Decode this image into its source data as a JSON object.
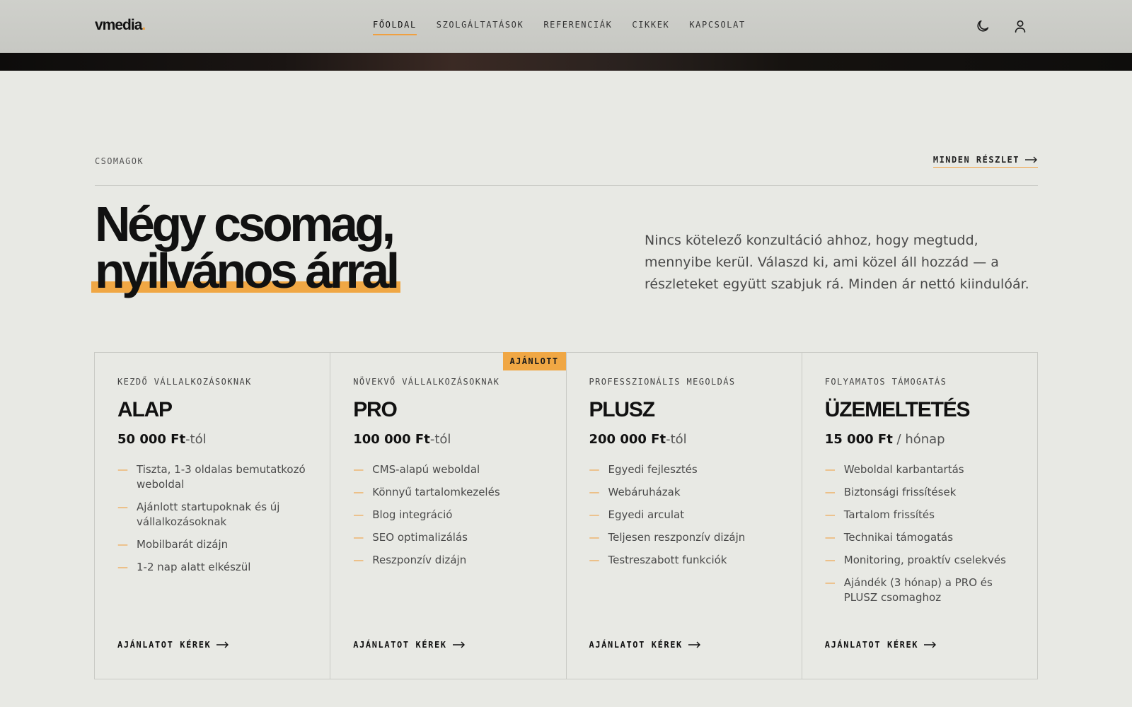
{
  "header": {
    "logo": "vmedia",
    "logo_dot": ".",
    "nav": [
      {
        "label": "FŐOLDAL",
        "active": true
      },
      {
        "label": "SZOLGÁLTATÁSOK",
        "active": false
      },
      {
        "label": "REFERENCIÁK",
        "active": false
      },
      {
        "label": "CIKKEK",
        "active": false
      },
      {
        "label": "KAPCSOLAT",
        "active": false
      }
    ],
    "icons": [
      "moon-icon",
      "user-icon"
    ]
  },
  "section": {
    "eyebrow": "CSOMAGOK",
    "all_link": "MINDEN RÉSZLET",
    "headline_line1": "Négy csomag,",
    "headline_line2": "nyilvános árral",
    "intro": "Nincs kötelező konzultáció ahhoz, hogy megtudd, mennyibe kerül. Válaszd ki, ami közel áll hozzád — a részleteket együtt szabjuk rá. Minden ár nettó kiindulóár."
  },
  "cards": [
    {
      "eyebrow": "KEZDŐ VÁLLALKOZÁSOKNAK",
      "title": "ALAP",
      "price_amount": "50 000 Ft",
      "price_suffix": "-tól",
      "features": [
        "Tiszta, 1-3 oldalas bemutatkozó weboldal",
        "Ajánlott startupoknak és új vállalkozásoknak",
        "Mobilbarát dizájn",
        "1-2 nap alatt elkészül"
      ],
      "cta": "AJÁNLATOT KÉREK",
      "badge": ""
    },
    {
      "eyebrow": "NÖVEKVŐ VÁLLALKOZÁSOKNAK",
      "title": "PRO",
      "price_amount": "100 000 Ft",
      "price_suffix": "-tól",
      "features": [
        "CMS-alapú weboldal",
        "Könnyű tartalomkezelés",
        "Blog integráció",
        "SEO optimalizálás",
        "Reszponzív dizájn"
      ],
      "cta": "AJÁNLATOT KÉREK",
      "badge": "AJÁNLOTT"
    },
    {
      "eyebrow": "PROFESSZIONÁLIS MEGOLDÁS",
      "title": "PLUSZ",
      "price_amount": "200 000 Ft",
      "price_suffix": "-tól",
      "features": [
        "Egyedi fejlesztés",
        "Webáruházak",
        "Egyedi arculat",
        "Teljesen reszponzív dizájn",
        "Testreszabott funkciók"
      ],
      "cta": "AJÁNLATOT KÉREK",
      "badge": ""
    },
    {
      "eyebrow": "FOLYAMATOS TÁMOGATÁS",
      "title": "ÜZEMELTETÉS",
      "price_amount": "15 000 Ft",
      "price_suffix": " / hónap",
      "features": [
        "Weboldal karbantartás",
        "Biztonsági frissítések",
        "Tartalom frissítés",
        "Technikai támogatás",
        "Monitoring, proaktív cselekvés",
        "Ajándék (3 hónap) a PRO és PLUSZ csomaghoz"
      ],
      "cta": "AJÁNLATOT KÉREK",
      "badge": ""
    }
  ],
  "colors": {
    "accent": "#f0a744",
    "background": "#e8e9e4",
    "text": "#111111"
  }
}
